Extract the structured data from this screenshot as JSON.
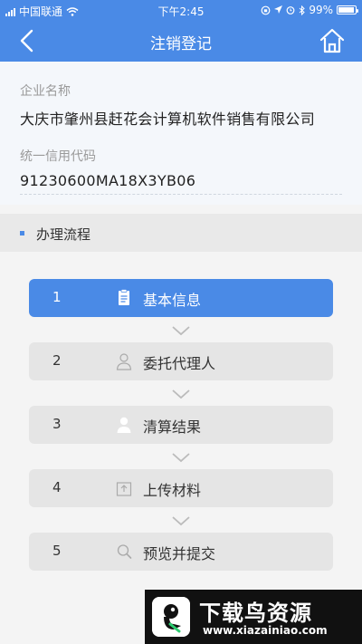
{
  "status_bar": {
    "carrier": "中国联通",
    "time": "下午2:45",
    "battery": "99%"
  },
  "nav": {
    "title": "注销登记",
    "back_icon": "chevron-left-icon",
    "home_icon": "home-icon"
  },
  "company": {
    "name_label": "企业名称",
    "name_value": "大庆市肇州县赶花会计算机软件销售有限公司",
    "credit_label": "统一信用代码",
    "credit_value": "91230600MA18X3YB06"
  },
  "process": {
    "title": "办理流程",
    "steps": [
      {
        "number": "1",
        "label": "基本信息",
        "icon": "document-icon",
        "active": true
      },
      {
        "number": "2",
        "label": "委托代理人",
        "icon": "person-outline-icon",
        "active": false
      },
      {
        "number": "3",
        "label": "清算结果",
        "icon": "person-filled-icon",
        "active": false
      },
      {
        "number": "4",
        "label": "上传材料",
        "icon": "upload-icon",
        "active": false
      },
      {
        "number": "5",
        "label": "预览并提交",
        "icon": "search-icon",
        "active": false
      }
    ]
  },
  "watermark": {
    "title": "下载鸟资源",
    "url": "www.xiazainiao.com"
  },
  "colors": {
    "primary": "#4a8ae6",
    "step_inactive": "#e5e5e5"
  }
}
